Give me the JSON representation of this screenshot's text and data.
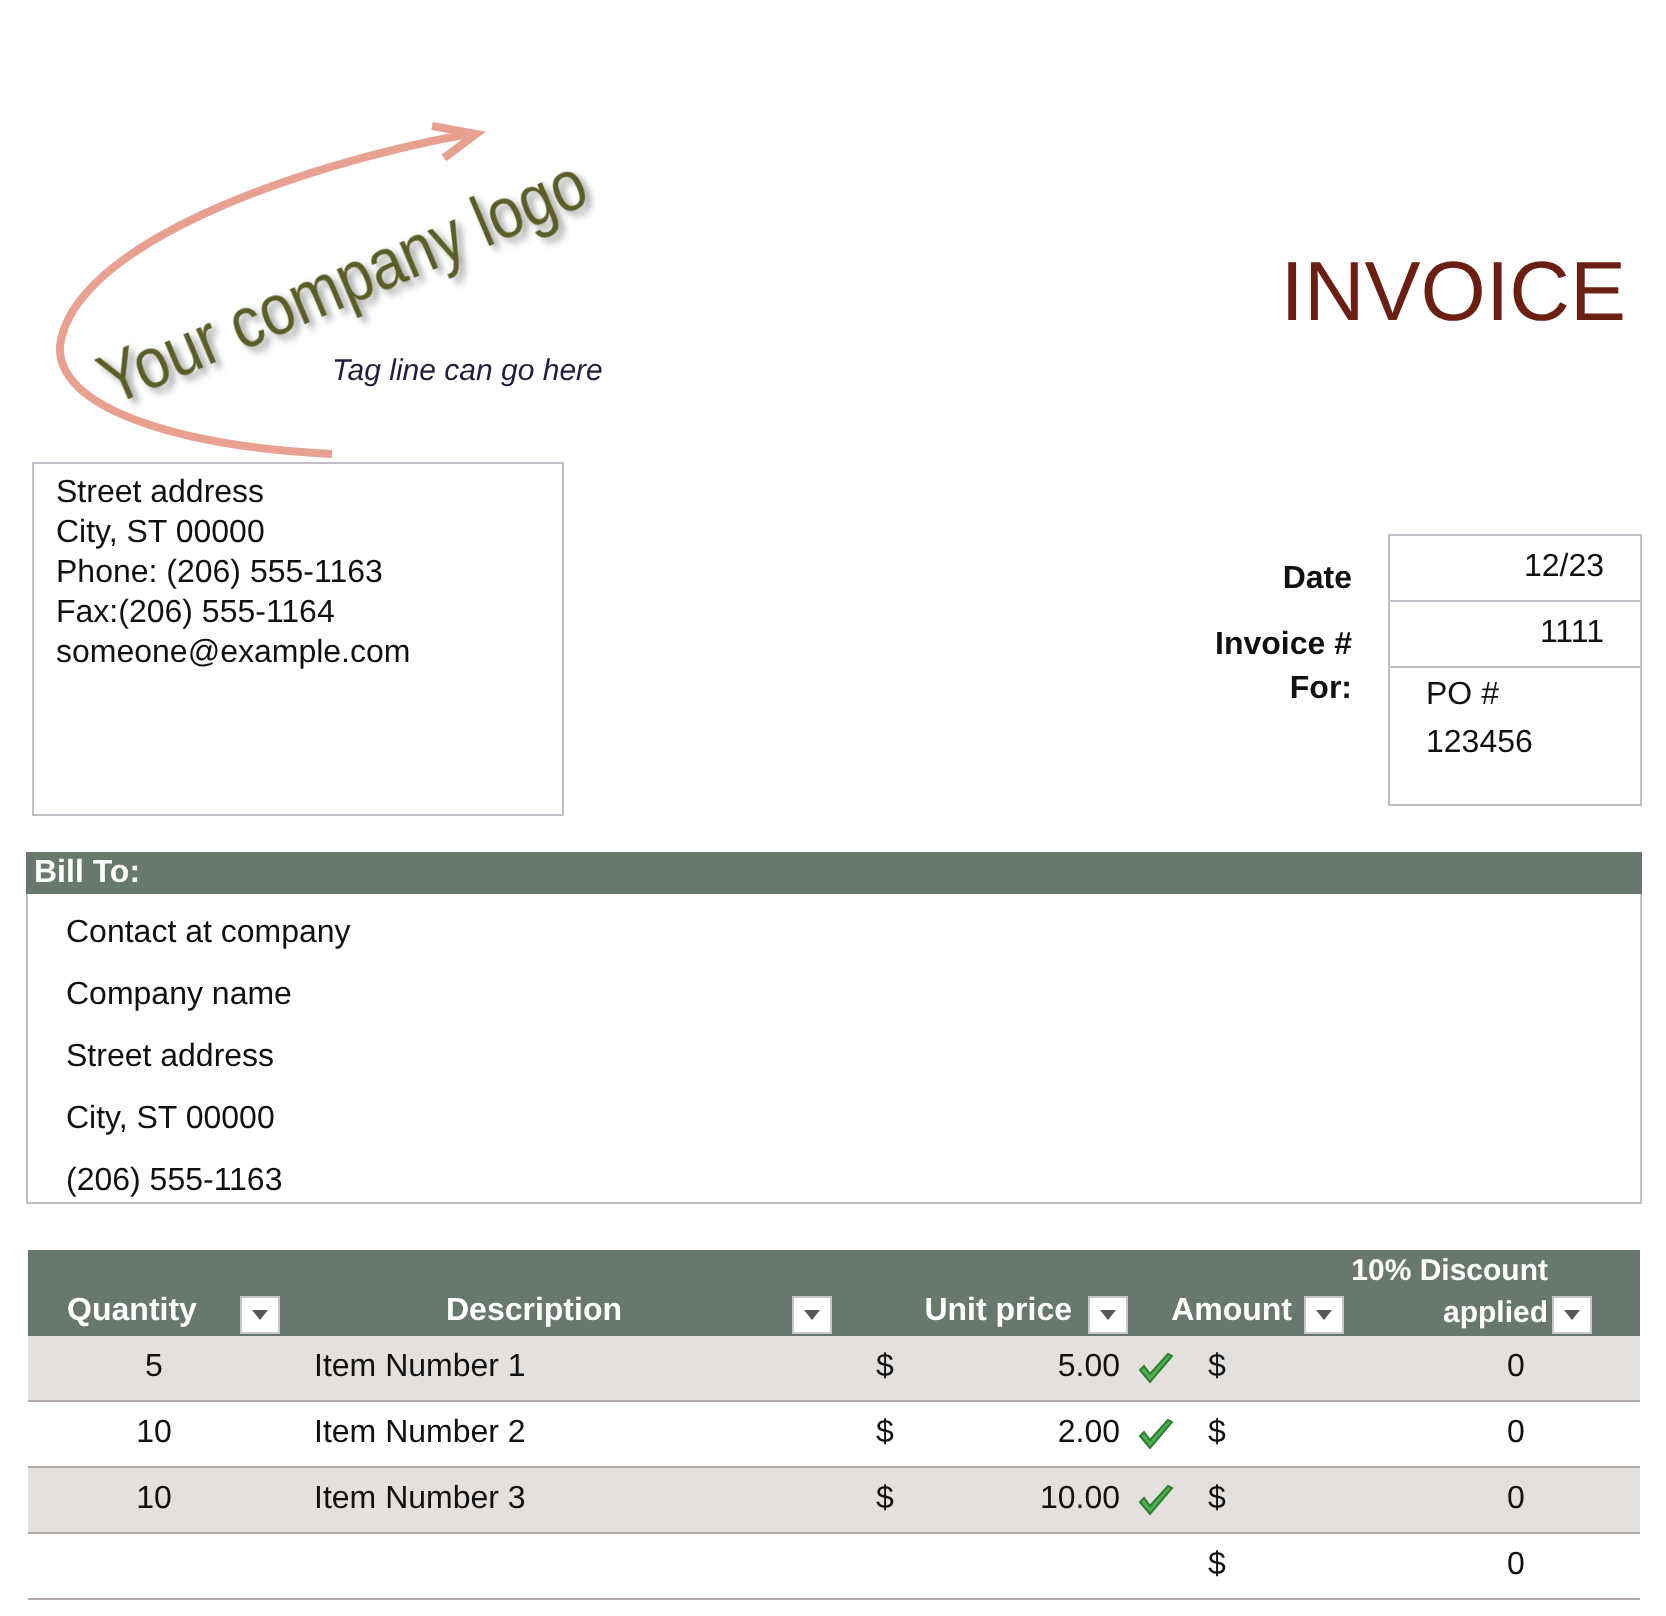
{
  "logo": {
    "text": "Your company logo",
    "tagline": "Tag line can go here"
  },
  "title": "INVOICE",
  "company_address": [
    "Street address",
    "City, ST  00000",
    "Phone: (206) 555-1163",
    "Fax:(206) 555-1164",
    "someone@example.com"
  ],
  "invoice_info": [
    {
      "label": "Date",
      "value": "12/23"
    },
    {
      "label": "Invoice #",
      "value": "1111"
    },
    {
      "label": "For:",
      "value": "PO # 123456"
    }
  ],
  "bill_to": {
    "heading": "Bill To:",
    "lines": [
      "Contact at company",
      "Company name",
      "Street address",
      "City, ST  00000",
      "(206) 555-1163"
    ]
  },
  "table": {
    "columns": [
      "Quantity",
      "Description",
      "Unit price",
      "Amount",
      "10% Discount applied"
    ],
    "rows": [
      {
        "quantity": "5",
        "description": "Item Number 1",
        "price_currency": "$",
        "unit_price": "5.00",
        "checked": true,
        "amount_currency": "$",
        "discount": "0"
      },
      {
        "quantity": "10",
        "description": "Item Number 2",
        "price_currency": "$",
        "unit_price": "2.00",
        "checked": true,
        "amount_currency": "$",
        "discount": "0"
      },
      {
        "quantity": "10",
        "description": "Item Number 3",
        "price_currency": "$",
        "unit_price": "10.00",
        "checked": true,
        "amount_currency": "$",
        "discount": "0"
      },
      {
        "amount_currency": "$",
        "discount": "0",
        "checked": false
      }
    ]
  }
}
